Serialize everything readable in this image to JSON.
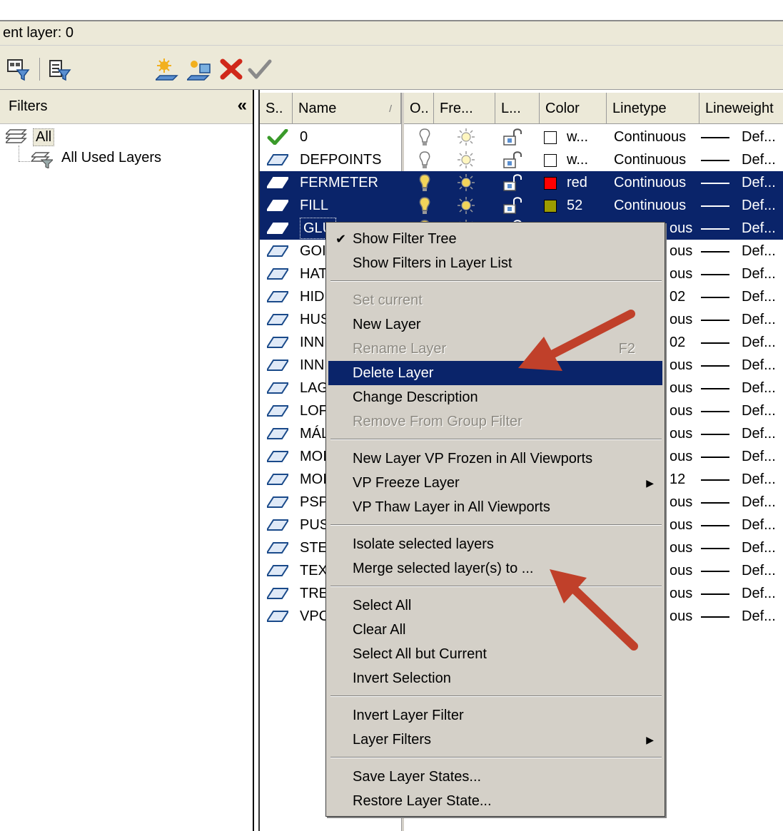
{
  "header": {
    "current_layer": "ent layer: 0"
  },
  "toolbar": {
    "icons": [
      "new-property-filter-icon",
      "new-group-filter-icon",
      "new-layer-icon",
      "new-layer-vp-frozen-icon",
      "delete-layer-icon",
      "set-current-icon"
    ]
  },
  "filters": {
    "title": "Filters",
    "collapse": "«",
    "tree_root": "All",
    "tree_child": "All Used Layers"
  },
  "grid": {
    "columns": [
      "S..",
      "Name",
      "O..",
      "Fre...",
      "L...",
      "Color",
      "Linetype",
      "Lineweight"
    ],
    "sort_indicator": "/",
    "rows": [
      {
        "status": "current",
        "name": "0",
        "color_swatch": "#ffffff",
        "color": "w...",
        "linetype": "Continuous",
        "lineweight": "Def...",
        "selected": false
      },
      {
        "status": "layer",
        "name": "DEFPOINTS",
        "color_swatch": "#ffffff",
        "color": "w...",
        "linetype": "Continuous",
        "lineweight": "Def...",
        "selected": false
      },
      {
        "status": "layer",
        "name": "FERMETER",
        "color_swatch": "#ff0000",
        "color": "red",
        "linetype": "Continuous",
        "lineweight": "Def...",
        "selected": true
      },
      {
        "status": "layer",
        "name": "FILL",
        "color_swatch": "#9c9c00",
        "color": "52",
        "linetype": "Continuous",
        "lineweight": "Def...",
        "selected": true
      },
      {
        "status": "layer",
        "name": "GLU",
        "linetype": "ous",
        "lineweight": "Def...",
        "selected": true,
        "focus": true
      },
      {
        "status": "layer",
        "name": "GOI",
        "linetype": "ous",
        "lineweight": "Def..."
      },
      {
        "status": "layer",
        "name": "HAT",
        "linetype": "ous",
        "lineweight": "Def..."
      },
      {
        "status": "layer",
        "name": "HID",
        "linetype": "02",
        "lineweight": "Def..."
      },
      {
        "status": "layer",
        "name": "HUS",
        "linetype": "ous",
        "lineweight": "Def..."
      },
      {
        "status": "layer",
        "name": "INN",
        "linetype": "02",
        "lineweight": "Def..."
      },
      {
        "status": "layer",
        "name": "INN",
        "linetype": "ous",
        "lineweight": "Def..."
      },
      {
        "status": "layer",
        "name": "LAG",
        "linetype": "ous",
        "lineweight": "Def..."
      },
      {
        "status": "layer",
        "name": "LOF",
        "linetype": "ous",
        "lineweight": "Def..."
      },
      {
        "status": "layer",
        "name": "MÁL",
        "linetype": "ous",
        "lineweight": "Def..."
      },
      {
        "status": "layer",
        "name": "MOI",
        "linetype": "ous",
        "lineweight": "Def..."
      },
      {
        "status": "layer",
        "name": "MOI",
        "linetype": "12",
        "lineweight": "Def..."
      },
      {
        "status": "layer",
        "name": "PSP",
        "linetype": "ous",
        "lineweight": "Def..."
      },
      {
        "status": "layer",
        "name": "PUS",
        "linetype": "ous",
        "lineweight": "Def..."
      },
      {
        "status": "layer",
        "name": "STE",
        "linetype": "ous",
        "lineweight": "Def..."
      },
      {
        "status": "layer",
        "name": "TEX",
        "linetype": "ous",
        "lineweight": "Def..."
      },
      {
        "status": "layer",
        "name": "TRE",
        "linetype": "ous",
        "lineweight": "Def..."
      },
      {
        "status": "layer",
        "name": "VPC",
        "linetype": "ous",
        "lineweight": "Def..."
      }
    ]
  },
  "context_menu": {
    "items": [
      {
        "label": "Show Filter Tree",
        "checked": true
      },
      {
        "label": "Show Filters in Layer List"
      },
      {
        "sep": true
      },
      {
        "label": "Set current",
        "disabled": true
      },
      {
        "label": "New Layer"
      },
      {
        "label": "Rename Layer",
        "shortcut": "F2",
        "disabled": true
      },
      {
        "label": "Delete Layer",
        "highlighted": true
      },
      {
        "label": "Change Description"
      },
      {
        "label": "Remove From Group Filter",
        "disabled": true
      },
      {
        "sep": true
      },
      {
        "label": "New Layer VP Frozen in All Viewports"
      },
      {
        "label": "VP Freeze Layer",
        "submenu": true
      },
      {
        "label": "VP Thaw Layer in All Viewports"
      },
      {
        "sep": true
      },
      {
        "label": "Isolate selected layers"
      },
      {
        "label": "Merge selected layer(s) to ..."
      },
      {
        "sep": true
      },
      {
        "label": "Select All"
      },
      {
        "label": "Clear All"
      },
      {
        "label": "Select All but Current"
      },
      {
        "label": "Invert Selection"
      },
      {
        "sep": true
      },
      {
        "label": "Invert Layer Filter"
      },
      {
        "label": "Layer Filters",
        "submenu": true
      },
      {
        "sep": true
      },
      {
        "label": "Save Layer States..."
      },
      {
        "label": "Restore Layer State..."
      }
    ]
  },
  "annotations": {
    "arrow_color": "#c0402a"
  }
}
